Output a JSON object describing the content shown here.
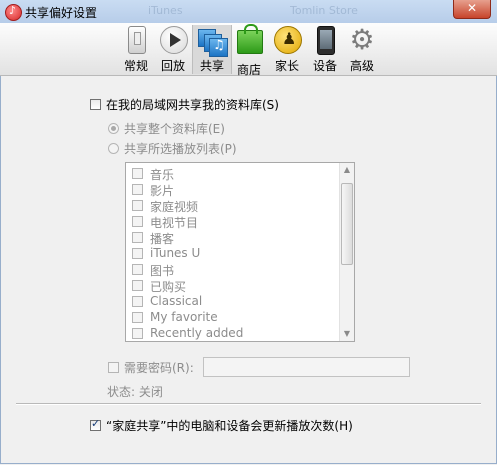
{
  "window": {
    "title": "共享偏好设置"
  },
  "ghost_titles": [
    "iTunes",
    "Tomlin Store"
  ],
  "toolbar": {
    "items": [
      {
        "label": "常规",
        "icon": "general-icon"
      },
      {
        "label": "回放",
        "icon": "playback-icon"
      },
      {
        "label": "共享",
        "icon": "sharing-icon",
        "active": true
      },
      {
        "label": "商店",
        "icon": "store-icon"
      },
      {
        "label": "家长",
        "icon": "parental-icon"
      },
      {
        "label": "设备",
        "icon": "device-icon"
      },
      {
        "label": "高级",
        "icon": "gear-icon"
      }
    ]
  },
  "sharing": {
    "share_library_label": "在我的局域网共享我的资料库(S)",
    "share_library_checked": false,
    "share_entire_label": "共享整个资料库(E)",
    "share_selected_label": "共享所选播放列表(P)",
    "playlists": [
      "音乐",
      "影片",
      "家庭视频",
      "电视节目",
      "播客",
      "iTunes U",
      "图书",
      "已购买",
      "Classical",
      "My favorite",
      "Recently added"
    ],
    "require_password_label": "需要密码(R):",
    "password_value": "",
    "status_text": "状态: 关闭",
    "home_sharing_label": "“家庭共享”中的电脑和设备会更新播放次数(H)",
    "home_sharing_checked": true
  },
  "colors": {
    "title_bar": "#c9dcf2",
    "close_button": "#c7442b",
    "disabled_text": "#8c8c8c"
  }
}
